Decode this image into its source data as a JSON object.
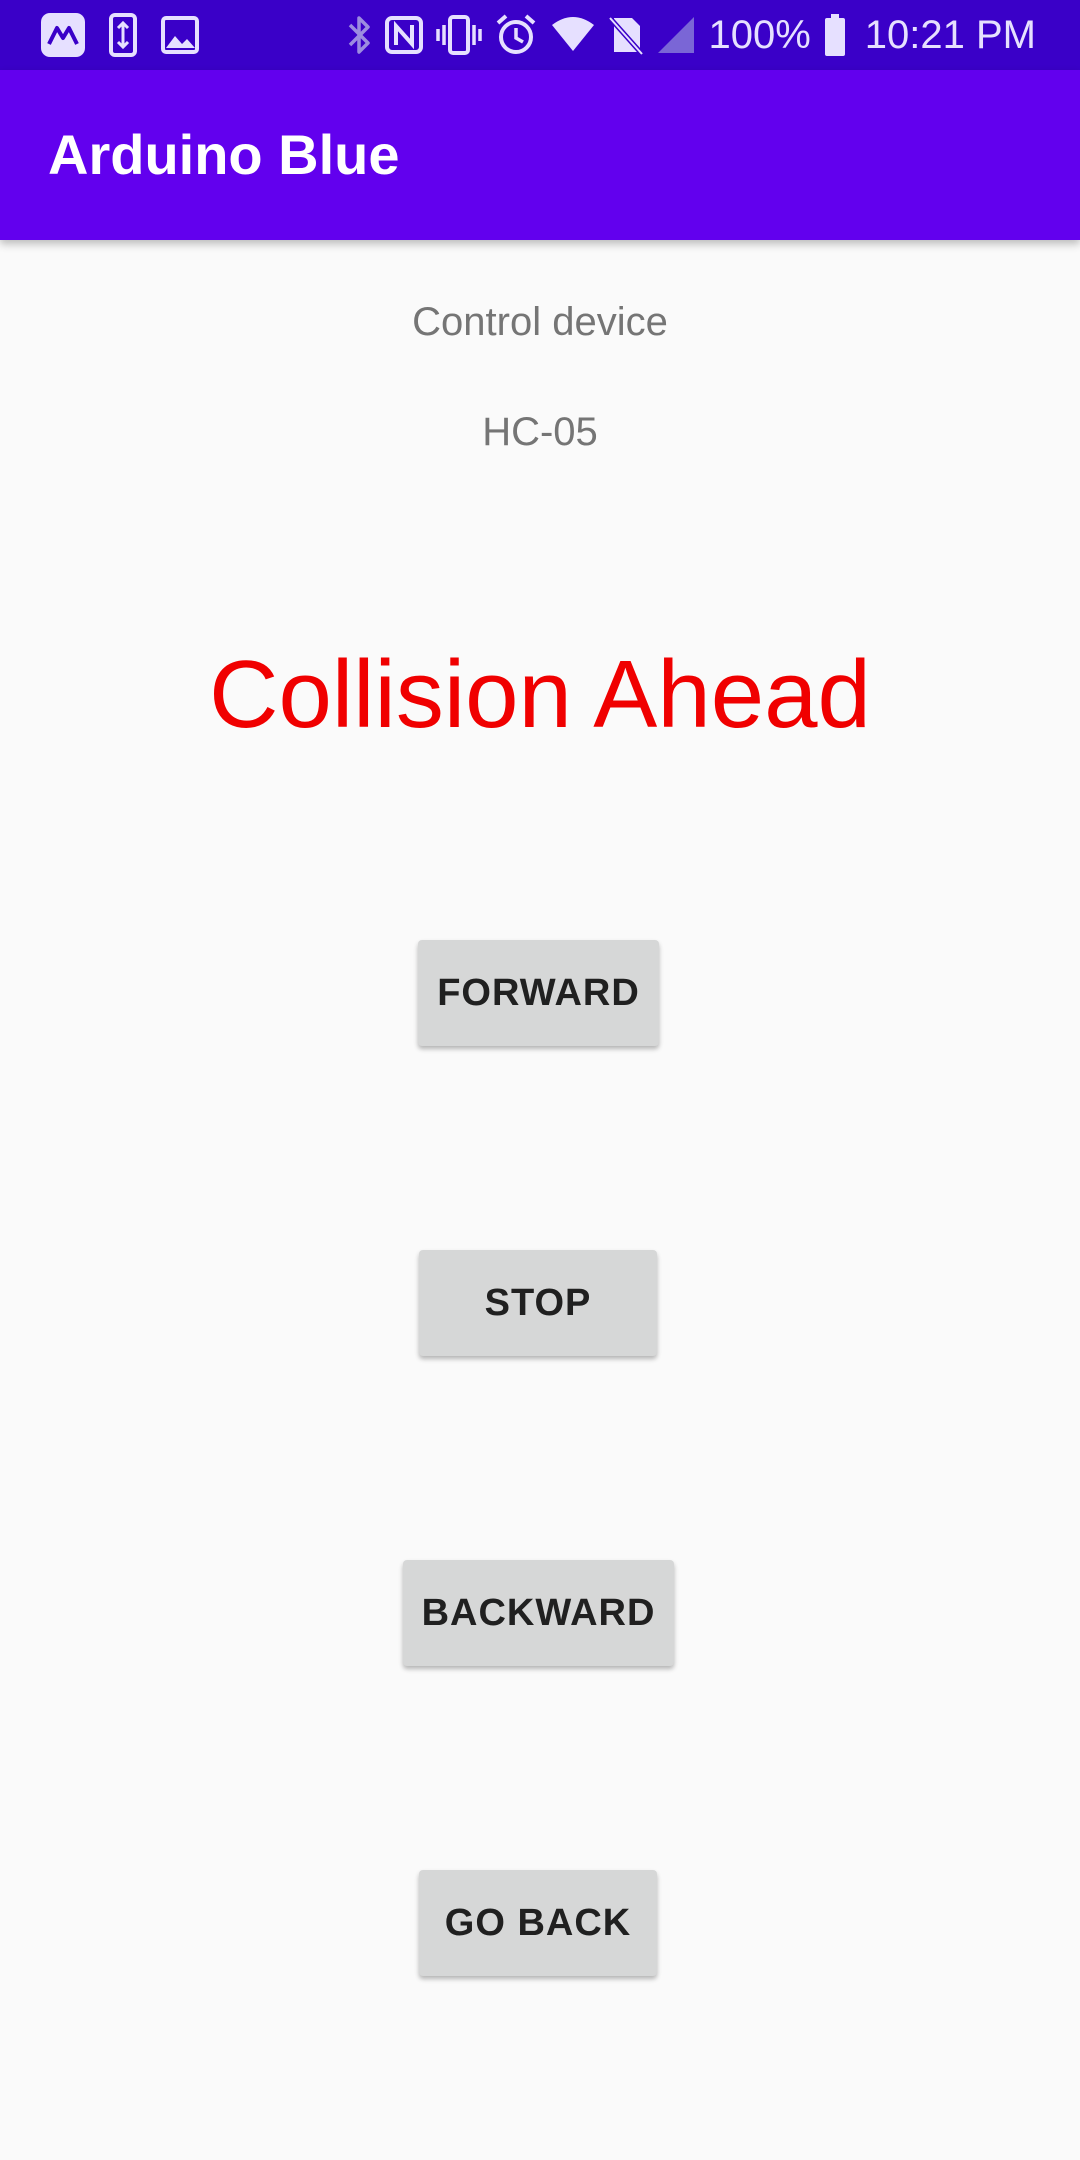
{
  "status_bar": {
    "left_icons": [
      "app-notification-icon",
      "phone-transfer-icon",
      "gallery-icon"
    ],
    "right_icons": [
      "bluetooth-icon",
      "nfc-icon",
      "vibrate-icon",
      "alarm-icon",
      "wifi-icon",
      "no-sim-icon",
      "signal-icon",
      "battery-icon"
    ],
    "battery_percent": "100%",
    "time": "10:21 PM"
  },
  "app_bar": {
    "title": "Arduino Blue",
    "color": "#6200EE"
  },
  "main": {
    "control_label": "Control device",
    "device_name": "HC-05",
    "warning_text": "Collision Ahead",
    "warning_color": "#F00000",
    "buttons": {
      "forward": "FORWARD",
      "stop": "STOP",
      "backward": "BACKWARD",
      "go_back": "GO BACK"
    }
  }
}
